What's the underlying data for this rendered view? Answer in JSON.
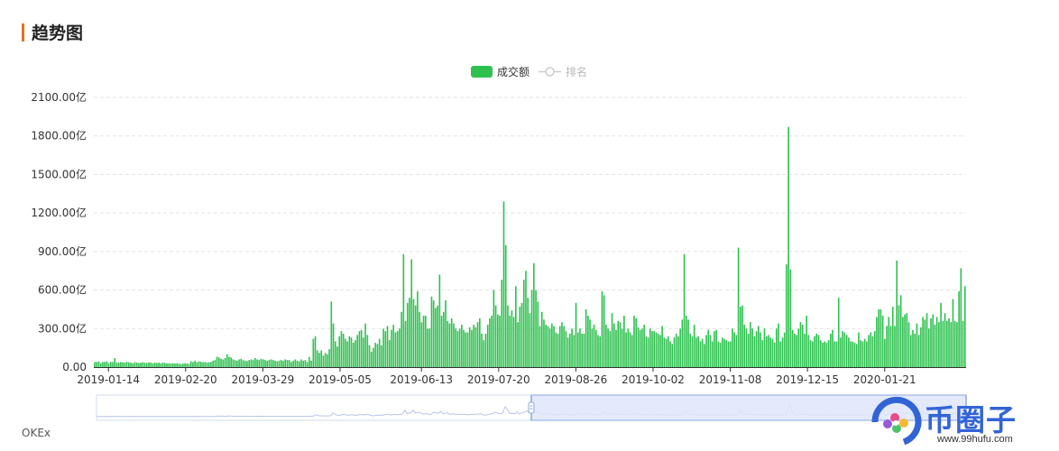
{
  "page": {
    "title": "趋势图",
    "source": "OKEx"
  },
  "watermark": {
    "text": "币圈子",
    "url": "www.99hufu.com"
  },
  "colors": {
    "accent": "#e8711d",
    "bar": "#2fc150",
    "zoom_fill": "#dfe6fa",
    "zoom_border": "#8da6e6"
  },
  "legend": [
    {
      "label": "成交额",
      "active": true,
      "icon": "rect-swatch"
    },
    {
      "label": "排名",
      "active": false,
      "icon": "line-circle"
    }
  ],
  "chart_data": {
    "type": "bar",
    "series_name": "成交额",
    "y_unit": "亿",
    "y_ticks": [
      "0.00",
      "300.00亿",
      "600.00亿",
      "900.00亿",
      "1200.00亿",
      "1500.00亿",
      "1800.00亿",
      "2100.00亿"
    ],
    "ylim": [
      0,
      2100
    ],
    "x_start": "2019-01-07",
    "x_end": "2020-02-29",
    "x_tick_labels": [
      "2019-01-14",
      "2019-02-20",
      "2019-03-29",
      "2019-05-05",
      "2019-06-13",
      "2019-07-20",
      "2019-08-26",
      "2019-10-02",
      "2019-11-08",
      "2019-12-15",
      "2020-01-21"
    ],
    "grid": true,
    "legend_position": "top-center",
    "zoom_range": [
      0.5,
      1.0
    ],
    "values": [
      40,
      40,
      45,
      30,
      40,
      40,
      45,
      30,
      40,
      40,
      70,
      35,
      35,
      40,
      38,
      35,
      42,
      38,
      35,
      30,
      38,
      35,
      32,
      35,
      38,
      35,
      32,
      38,
      35,
      30,
      35,
      32,
      35,
      30,
      35,
      32,
      30,
      30,
      28,
      30,
      28,
      30,
      28,
      25,
      28,
      30,
      28,
      25,
      45,
      40,
      50,
      38,
      45,
      42,
      38,
      40,
      35,
      38,
      40,
      50,
      55,
      80,
      75,
      65,
      60,
      70,
      100,
      80,
      75,
      60,
      55,
      50,
      60,
      65,
      55,
      50,
      45,
      55,
      60,
      55,
      70,
      60,
      55,
      65,
      60,
      55,
      50,
      55,
      60,
      55,
      50,
      45,
      50,
      55,
      50,
      60,
      55,
      55,
      40,
      50,
      60,
      50,
      45,
      60,
      50,
      55,
      40,
      80,
      50,
      220,
      240,
      130,
      110,
      130,
      90,
      110,
      100,
      140,
      510,
      340,
      200,
      160,
      240,
      280,
      260,
      220,
      200,
      240,
      230,
      190,
      210,
      250,
      280,
      290,
      230,
      340,
      250,
      170,
      120,
      150,
      190,
      180,
      220,
      170,
      300,
      280,
      320,
      210,
      290,
      330,
      270,
      280,
      300,
      430,
      880,
      360,
      500,
      540,
      840,
      530,
      480,
      590,
      430,
      350,
      400,
      400,
      300,
      300,
      550,
      520,
      460,
      480,
      720,
      400,
      430,
      520,
      360,
      340,
      380,
      340,
      300,
      280,
      300,
      330,
      290,
      270,
      270,
      310,
      290,
      330,
      310,
      350,
      380,
      260,
      210,
      260,
      330,
      380,
      400,
      600,
      480,
      410,
      400,
      680,
      1290,
      950,
      480,
      400,
      440,
      390,
      630,
      350,
      470,
      500,
      680,
      750,
      540,
      420,
      600,
      810,
      600,
      510,
      320,
      430,
      370,
      330,
      320,
      300,
      340,
      320,
      270,
      260,
      320,
      350,
      320,
      280,
      230,
      260,
      300,
      250,
      500,
      270,
      300,
      260,
      260,
      450,
      400,
      370,
      300,
      330,
      290,
      250,
      240,
      590,
      560,
      330,
      300,
      280,
      420,
      340,
      290,
      360,
      350,
      300,
      400,
      270,
      300,
      270,
      250,
      400,
      380,
      310,
      290,
      300,
      330,
      240,
      230,
      300,
      280,
      280,
      270,
      260,
      250,
      320,
      230,
      220,
      240,
      200,
      180,
      230,
      260,
      240,
      300,
      370,
      880,
      400,
      370,
      260,
      240,
      330,
      230,
      240,
      200,
      220,
      180,
      250,
      290,
      250,
      200,
      280,
      290,
      200,
      190,
      230,
      220,
      210,
      200,
      200,
      300,
      270,
      250,
      930,
      470,
      480,
      330,
      300,
      260,
      350,
      300,
      240,
      280,
      320,
      270,
      210,
      300,
      240,
      250,
      230,
      220,
      190,
      300,
      340,
      200,
      230,
      270,
      800,
      1870,
      760,
      290,
      260,
      250,
      300,
      350,
      330,
      260,
      400,
      250,
      210,
      200,
      240,
      260,
      250,
      210,
      190,
      200,
      190,
      210,
      260,
      290,
      200,
      200,
      540,
      230,
      280,
      270,
      250,
      230,
      200,
      200,
      190,
      180,
      270,
      210,
      200,
      220,
      200,
      250,
      270,
      240,
      280,
      390,
      450,
      450,
      400,
      220,
      320,
      390,
      320,
      470,
      320,
      830,
      480,
      560,
      390,
      410,
      420,
      350,
      250,
      290,
      260,
      340,
      250,
      310,
      390,
      370,
      420,
      300,
      380,
      410,
      330,
      390,
      350,
      500,
      360,
      420,
      360,
      380,
      350,
      530,
      360,
      350,
      590,
      770,
      360,
      630
    ]
  }
}
